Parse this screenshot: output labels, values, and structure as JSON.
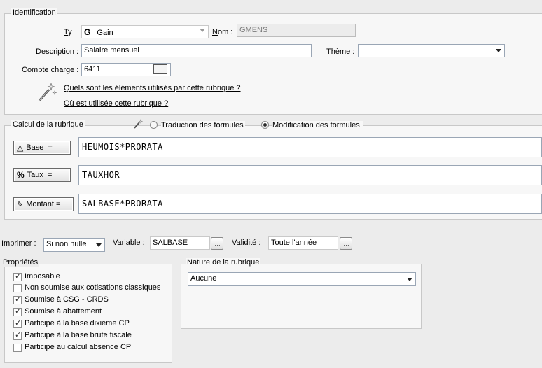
{
  "identification": {
    "title": "Identification",
    "type_label": "Type :",
    "type_value": "Gain",
    "type_icon": "G",
    "nom_label": "Nom :",
    "nom_value": "GMENS",
    "description_label": "Description :",
    "description_value": "Salaire mensuel",
    "theme_label": "Thème :",
    "theme_value": "",
    "compte_label": "Compte charge :",
    "compte_value": "6411",
    "link_elements": "Quels sont les éléments utilisés par cette rubrique ?",
    "link_usage": "Où est utilisée cette rubrique ?"
  },
  "calcul": {
    "title": "Calcul de la rubrique",
    "option_traduction": "Traduction des formules",
    "option_modification": "Modification des formules",
    "selected": "modification",
    "rows": [
      {
        "button": "Base  =",
        "icon": "△",
        "formula": "HEUMOIS*PRORATA"
      },
      {
        "button": "Taux  =",
        "icon": "%",
        "formula": "TAUXHOR"
      },
      {
        "button": "Montant =",
        "icon": "✎",
        "formula": "SALBASE*PRORATA"
      }
    ]
  },
  "bottom": {
    "imprimer_label": "Imprimer :",
    "imprimer_value": "Si non nulle",
    "variable_label": "Variable :",
    "variable_value": "SALBASE",
    "validite_label": "Validité :",
    "validite_value": "Toute l'année"
  },
  "proprietes": {
    "title": "Propriétés",
    "items": [
      {
        "label": "Imposable",
        "checked": true
      },
      {
        "label": "Non soumise aux cotisations classiques",
        "checked": false
      },
      {
        "label": "Soumise à CSG - CRDS",
        "checked": true
      },
      {
        "label": "Soumise à abattement",
        "checked": true
      },
      {
        "label": "Participe à la base dixième CP",
        "checked": true
      },
      {
        "label": "Participe à la base brute fiscale",
        "checked": true
      },
      {
        "label": "Participe au calcul absence CP",
        "checked": false
      }
    ]
  },
  "nature": {
    "title": "Nature de la rubrique",
    "value": "Aucune"
  }
}
